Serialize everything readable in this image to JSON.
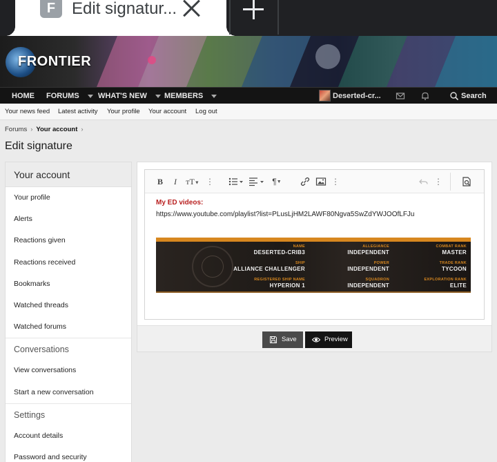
{
  "browser": {
    "tab_title": "Edit signatur...",
    "tab_favicon_letter": "F"
  },
  "site": {
    "logo_text": "FRONTIER"
  },
  "nav": {
    "home": "HOME",
    "forums": "FORUMS",
    "whats_new": "WHAT'S NEW",
    "members": "MEMBERS",
    "username": "Deserted-cr...",
    "search": "Search"
  },
  "subnav": {
    "items": [
      "Your news feed",
      "Latest activity",
      "Your profile",
      "Your account",
      "Log out"
    ]
  },
  "breadcrumb": {
    "forums": "Forums",
    "current": "Your account"
  },
  "page": {
    "title": "Edit signature"
  },
  "sidebar": {
    "heading": "Your account",
    "account_links": [
      "Your profile",
      "Alerts",
      "Reactions given",
      "Reactions received",
      "Bookmarks",
      "Watched threads",
      "Watched forums"
    ],
    "conversations_heading": "Conversations",
    "conversation_links": [
      "View conversations",
      "Start a new conversation"
    ],
    "settings_heading": "Settings",
    "settings_links": [
      "Account details",
      "Password and security"
    ]
  },
  "editor": {
    "toolbar_icons": [
      "bold-icon",
      "italic-icon",
      "font-size-icon",
      "more-text-icon",
      "list-icon",
      "align-icon",
      "paragraph-icon",
      "more-paragraph-icon",
      "link-icon",
      "image-icon",
      "more-insert-icon",
      "undo-icon",
      "more-options-icon",
      "preview-toggle-icon"
    ],
    "content_heading": "My ED videos:",
    "content_url": "https://www.youtube.com/playlist?list=PLusLjHM2LAWF80Ngva5SwZdYWJOOfLFJu"
  },
  "signature_card": {
    "accent": "#d7871f",
    "fields": [
      {
        "label": "NAME",
        "value": "DESERTED-CRIB3"
      },
      {
        "label": "ALLEGIANCE",
        "value": "INDEPENDENT"
      },
      {
        "label": "COMBAT RANK",
        "value": "MASTER"
      },
      {
        "label": "SHIP",
        "value": "ALLIANCE CHALLENGER"
      },
      {
        "label": "POWER",
        "value": "INDEPENDENT"
      },
      {
        "label": "TRADE RANK",
        "value": "TYCOON"
      },
      {
        "label": "REGISTERED SHIP NAME",
        "value": "HYPERION 1"
      },
      {
        "label": "SQUADRON",
        "value": "INDEPENDENT"
      },
      {
        "label": "EXPLORATION RANK",
        "value": "ELITE"
      }
    ]
  },
  "buttons": {
    "save": "Save",
    "preview": "Preview"
  },
  "colors": {
    "nav_bg": "#141414",
    "heading_red": "#b81f1f",
    "sig_orange": "#d7871f"
  }
}
